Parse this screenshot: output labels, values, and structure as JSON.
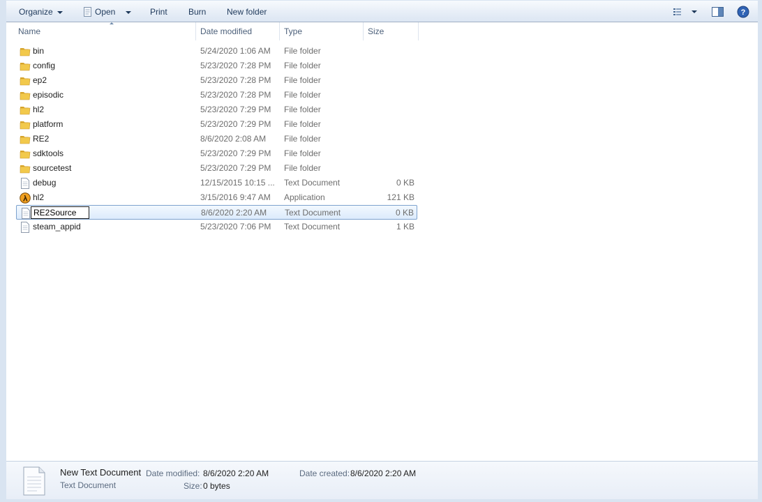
{
  "toolbar": {
    "organize_label": "Organize",
    "open_label": "Open",
    "print_label": "Print",
    "burn_label": "Burn",
    "new_folder_label": "New folder",
    "icons": [
      "view-options-icon",
      "preview-pane-icon",
      "help-icon"
    ]
  },
  "columns": {
    "name": "Name",
    "date_modified": "Date modified",
    "type": "Type",
    "size": "Size"
  },
  "files": [
    {
      "name": "bin",
      "date": "5/24/2020 1:06 AM",
      "type": "File folder",
      "size": "",
      "icon": "folder-icon"
    },
    {
      "name": "config",
      "date": "5/23/2020 7:28 PM",
      "type": "File folder",
      "size": "",
      "icon": "folder-icon"
    },
    {
      "name": "ep2",
      "date": "5/23/2020 7:28 PM",
      "type": "File folder",
      "size": "",
      "icon": "folder-icon"
    },
    {
      "name": "episodic",
      "date": "5/23/2020 7:28 PM",
      "type": "File folder",
      "size": "",
      "icon": "folder-icon"
    },
    {
      "name": "hl2",
      "date": "5/23/2020 7:29 PM",
      "type": "File folder",
      "size": "",
      "icon": "folder-icon"
    },
    {
      "name": "platform",
      "date": "5/23/2020 7:29 PM",
      "type": "File folder",
      "size": "",
      "icon": "folder-icon"
    },
    {
      "name": "RE2",
      "date": "8/6/2020 2:08 AM",
      "type": "File folder",
      "size": "",
      "icon": "folder-icon"
    },
    {
      "name": "sdktools",
      "date": "5/23/2020 7:29 PM",
      "type": "File folder",
      "size": "",
      "icon": "folder-icon"
    },
    {
      "name": "sourcetest",
      "date": "5/23/2020 7:29 PM",
      "type": "File folder",
      "size": "",
      "icon": "folder-icon"
    },
    {
      "name": "debug",
      "date": "12/15/2015 10:15 ...",
      "type": "Text Document",
      "size": "0 KB",
      "icon": "text-file-icon"
    },
    {
      "name": "hl2",
      "date": "3/15/2016 9:47 AM",
      "type": "Application",
      "size": "121 KB",
      "icon": "half-life-app-icon"
    },
    {
      "name": "RE2Source",
      "date": "8/6/2020 2:20 AM",
      "type": "Text Document",
      "size": "0 KB",
      "icon": "text-file-icon",
      "selected": true,
      "renaming": true
    },
    {
      "name": "steam_appid",
      "date": "5/23/2020 7:06 PM",
      "type": "Text Document",
      "size": "1 KB",
      "icon": "text-file-icon"
    }
  ],
  "details": {
    "name": "New Text Document",
    "type": "Text Document",
    "date_modified_label": "Date modified:",
    "date_modified": "8/6/2020 2:20 AM",
    "size_label": "Size:",
    "size": "0 bytes",
    "date_created_label": "Date created:",
    "date_created": "8/6/2020 2:20 AM",
    "icon": "text-document-large-icon"
  },
  "colors": {
    "toolbar_text": "#1e395b",
    "selection_border": "#7da2ce",
    "folder": "#e8b63c"
  }
}
